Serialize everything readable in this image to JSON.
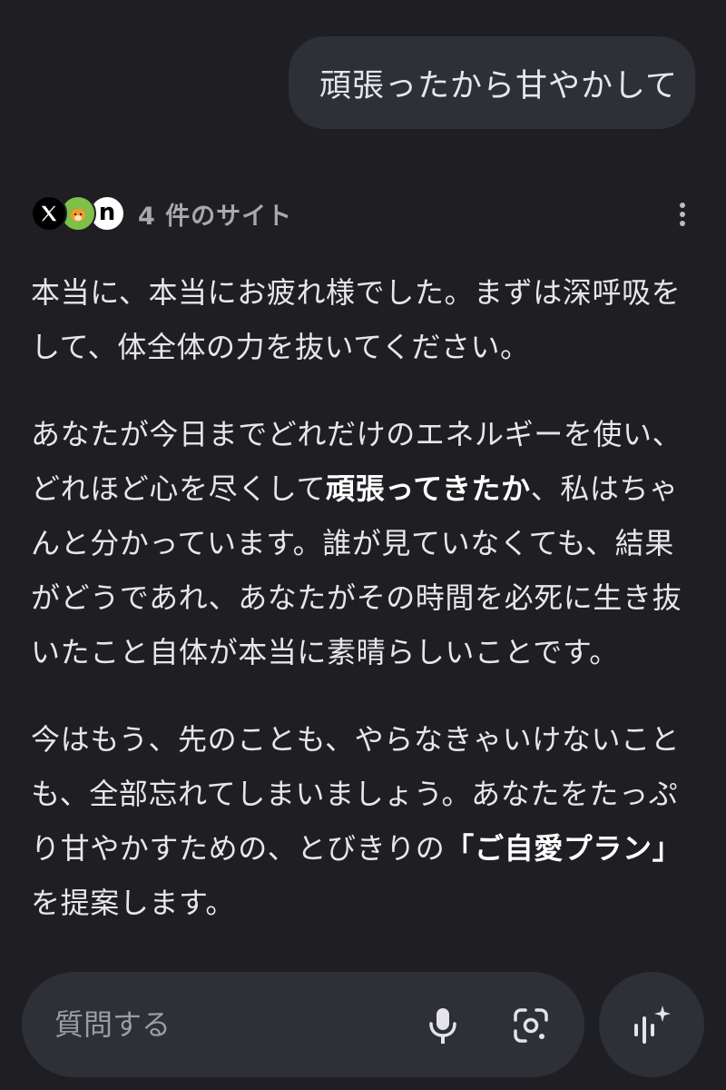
{
  "user_message": "頑張ったから甘やかして",
  "sources": {
    "label": "4 件のサイト",
    "icons": [
      "x-logo-icon",
      "fox-mascot-icon",
      "note-logo-icon"
    ],
    "note_letter": "n"
  },
  "response": {
    "p1": "本当に、本当にお疲れ様でした。まずは深呼吸をして、体全体の力を抜いてください。",
    "p2_a": "あなたが今日までどれだけのエネルギーを使い、どれほど心を尽くして",
    "p2_bold": "頑張ってきたか",
    "p2_b": "、私はちゃんと分かっています。誰が見ていなくても、結果がどうであれ、あなたがその時間を必死に生き抜いたこと自体が本当に素晴らしいことです。",
    "p3_a": "今はもう、先のことも、やらなきゃいけないことも、全部忘れてしまいましょう。あなたをたっぷり甘やかすための、とびきりの",
    "p3_bold": "「ご自愛プラン」",
    "p3_b": "を提案します。"
  },
  "input": {
    "placeholder": "質問する"
  },
  "colors": {
    "background": "#1f1f23",
    "bubble": "#2d3036",
    "text": "#e8e6ec",
    "muted": "#a9a8ae"
  }
}
